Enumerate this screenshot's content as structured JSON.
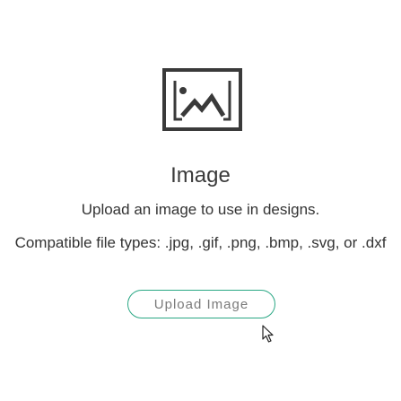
{
  "placeholder": {
    "icon": "image-placeholder-icon",
    "title": "Image",
    "description": "Upload an image to use in designs.",
    "file_types": "Compatible file types: .jpg, .gif, .png, .bmp, .svg, or .dxf"
  },
  "actions": {
    "upload_label": "Upload Image"
  },
  "colors": {
    "accent": "#2aa784",
    "icon": "#3a3a3a",
    "text": "#333333"
  },
  "cursor": {
    "icon": "mouse-pointer-icon"
  }
}
